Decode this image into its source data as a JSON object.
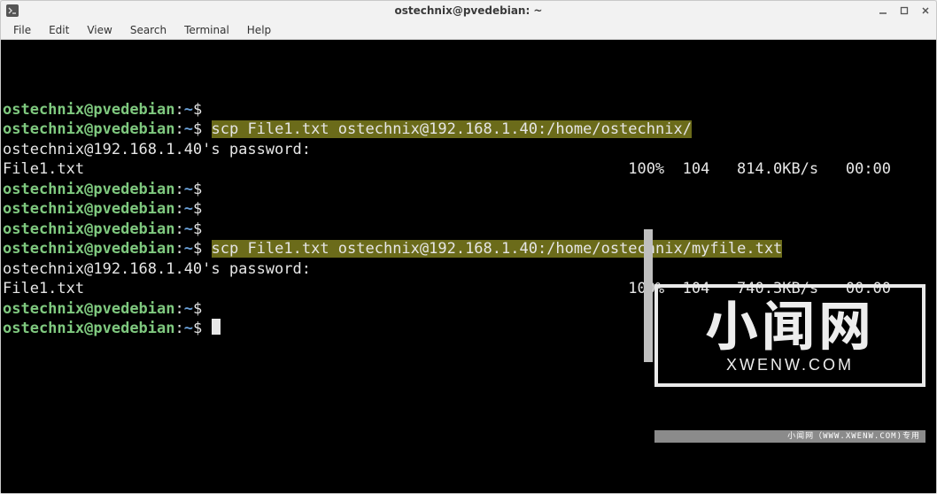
{
  "window": {
    "title": "ostechnix@pvedebian: ~"
  },
  "menu": {
    "file": "File",
    "edit": "Edit",
    "view": "View",
    "search": "Search",
    "terminal": "Terminal",
    "help": "Help"
  },
  "prompt": {
    "user": "ostechnix",
    "at": "@",
    "host": "pvedebian",
    "colon": ":",
    "path": "~",
    "dollar": "$"
  },
  "term": {
    "cmd1": "scp File1.txt ostechnix@192.168.1.40:/home/ostechnix/",
    "pwprompt": "ostechnix@192.168.1.40's password:",
    "file": "File1.txt",
    "stat1": "100%  104   814.0KB/s   00:00",
    "cmd2": "scp File1.txt ostechnix@192.168.1.40:/home/ostechnix/myfile.txt",
    "stat2": "100%  104   740.3KB/s   00:00"
  },
  "watermark": {
    "big": "小闻网",
    "sub": "XWENW.COM",
    "foot": "小闻网（WWW.XWENW.COM)专用"
  }
}
